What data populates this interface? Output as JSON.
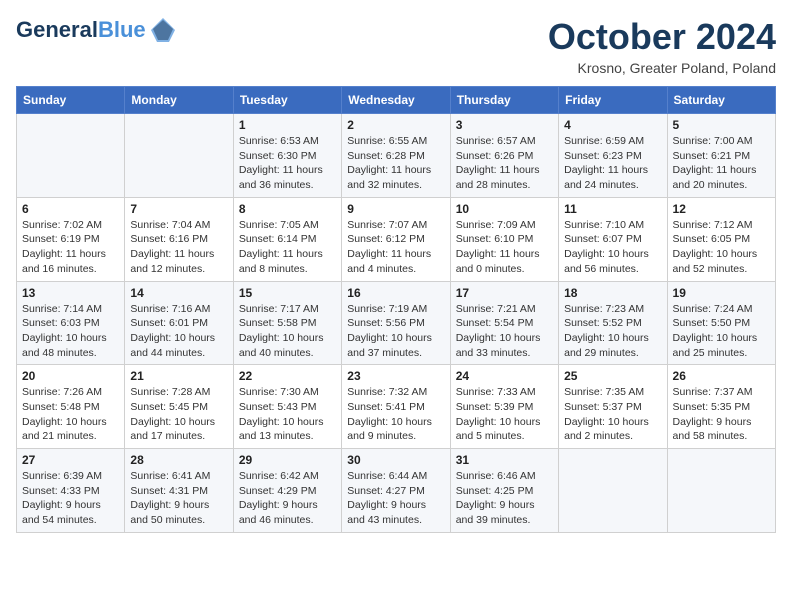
{
  "header": {
    "logo_line1": "General",
    "logo_line2": "Blue",
    "month": "October 2024",
    "location": "Krosno, Greater Poland, Poland"
  },
  "weekdays": [
    "Sunday",
    "Monday",
    "Tuesday",
    "Wednesday",
    "Thursday",
    "Friday",
    "Saturday"
  ],
  "weeks": [
    [
      {
        "day": "",
        "sunrise": "",
        "sunset": "",
        "daylight": ""
      },
      {
        "day": "",
        "sunrise": "",
        "sunset": "",
        "daylight": ""
      },
      {
        "day": "1",
        "sunrise": "Sunrise: 6:53 AM",
        "sunset": "Sunset: 6:30 PM",
        "daylight": "Daylight: 11 hours and 36 minutes."
      },
      {
        "day": "2",
        "sunrise": "Sunrise: 6:55 AM",
        "sunset": "Sunset: 6:28 PM",
        "daylight": "Daylight: 11 hours and 32 minutes."
      },
      {
        "day": "3",
        "sunrise": "Sunrise: 6:57 AM",
        "sunset": "Sunset: 6:26 PM",
        "daylight": "Daylight: 11 hours and 28 minutes."
      },
      {
        "day": "4",
        "sunrise": "Sunrise: 6:59 AM",
        "sunset": "Sunset: 6:23 PM",
        "daylight": "Daylight: 11 hours and 24 minutes."
      },
      {
        "day": "5",
        "sunrise": "Sunrise: 7:00 AM",
        "sunset": "Sunset: 6:21 PM",
        "daylight": "Daylight: 11 hours and 20 minutes."
      }
    ],
    [
      {
        "day": "6",
        "sunrise": "Sunrise: 7:02 AM",
        "sunset": "Sunset: 6:19 PM",
        "daylight": "Daylight: 11 hours and 16 minutes."
      },
      {
        "day": "7",
        "sunrise": "Sunrise: 7:04 AM",
        "sunset": "Sunset: 6:16 PM",
        "daylight": "Daylight: 11 hours and 12 minutes."
      },
      {
        "day": "8",
        "sunrise": "Sunrise: 7:05 AM",
        "sunset": "Sunset: 6:14 PM",
        "daylight": "Daylight: 11 hours and 8 minutes."
      },
      {
        "day": "9",
        "sunrise": "Sunrise: 7:07 AM",
        "sunset": "Sunset: 6:12 PM",
        "daylight": "Daylight: 11 hours and 4 minutes."
      },
      {
        "day": "10",
        "sunrise": "Sunrise: 7:09 AM",
        "sunset": "Sunset: 6:10 PM",
        "daylight": "Daylight: 11 hours and 0 minutes."
      },
      {
        "day": "11",
        "sunrise": "Sunrise: 7:10 AM",
        "sunset": "Sunset: 6:07 PM",
        "daylight": "Daylight: 10 hours and 56 minutes."
      },
      {
        "day": "12",
        "sunrise": "Sunrise: 7:12 AM",
        "sunset": "Sunset: 6:05 PM",
        "daylight": "Daylight: 10 hours and 52 minutes."
      }
    ],
    [
      {
        "day": "13",
        "sunrise": "Sunrise: 7:14 AM",
        "sunset": "Sunset: 6:03 PM",
        "daylight": "Daylight: 10 hours and 48 minutes."
      },
      {
        "day": "14",
        "sunrise": "Sunrise: 7:16 AM",
        "sunset": "Sunset: 6:01 PM",
        "daylight": "Daylight: 10 hours and 44 minutes."
      },
      {
        "day": "15",
        "sunrise": "Sunrise: 7:17 AM",
        "sunset": "Sunset: 5:58 PM",
        "daylight": "Daylight: 10 hours and 40 minutes."
      },
      {
        "day": "16",
        "sunrise": "Sunrise: 7:19 AM",
        "sunset": "Sunset: 5:56 PM",
        "daylight": "Daylight: 10 hours and 37 minutes."
      },
      {
        "day": "17",
        "sunrise": "Sunrise: 7:21 AM",
        "sunset": "Sunset: 5:54 PM",
        "daylight": "Daylight: 10 hours and 33 minutes."
      },
      {
        "day": "18",
        "sunrise": "Sunrise: 7:23 AM",
        "sunset": "Sunset: 5:52 PM",
        "daylight": "Daylight: 10 hours and 29 minutes."
      },
      {
        "day": "19",
        "sunrise": "Sunrise: 7:24 AM",
        "sunset": "Sunset: 5:50 PM",
        "daylight": "Daylight: 10 hours and 25 minutes."
      }
    ],
    [
      {
        "day": "20",
        "sunrise": "Sunrise: 7:26 AM",
        "sunset": "Sunset: 5:48 PM",
        "daylight": "Daylight: 10 hours and 21 minutes."
      },
      {
        "day": "21",
        "sunrise": "Sunrise: 7:28 AM",
        "sunset": "Sunset: 5:45 PM",
        "daylight": "Daylight: 10 hours and 17 minutes."
      },
      {
        "day": "22",
        "sunrise": "Sunrise: 7:30 AM",
        "sunset": "Sunset: 5:43 PM",
        "daylight": "Daylight: 10 hours and 13 minutes."
      },
      {
        "day": "23",
        "sunrise": "Sunrise: 7:32 AM",
        "sunset": "Sunset: 5:41 PM",
        "daylight": "Daylight: 10 hours and 9 minutes."
      },
      {
        "day": "24",
        "sunrise": "Sunrise: 7:33 AM",
        "sunset": "Sunset: 5:39 PM",
        "daylight": "Daylight: 10 hours and 5 minutes."
      },
      {
        "day": "25",
        "sunrise": "Sunrise: 7:35 AM",
        "sunset": "Sunset: 5:37 PM",
        "daylight": "Daylight: 10 hours and 2 minutes."
      },
      {
        "day": "26",
        "sunrise": "Sunrise: 7:37 AM",
        "sunset": "Sunset: 5:35 PM",
        "daylight": "Daylight: 9 hours and 58 minutes."
      }
    ],
    [
      {
        "day": "27",
        "sunrise": "Sunrise: 6:39 AM",
        "sunset": "Sunset: 4:33 PM",
        "daylight": "Daylight: 9 hours and 54 minutes."
      },
      {
        "day": "28",
        "sunrise": "Sunrise: 6:41 AM",
        "sunset": "Sunset: 4:31 PM",
        "daylight": "Daylight: 9 hours and 50 minutes."
      },
      {
        "day": "29",
        "sunrise": "Sunrise: 6:42 AM",
        "sunset": "Sunset: 4:29 PM",
        "daylight": "Daylight: 9 hours and 46 minutes."
      },
      {
        "day": "30",
        "sunrise": "Sunrise: 6:44 AM",
        "sunset": "Sunset: 4:27 PM",
        "daylight": "Daylight: 9 hours and 43 minutes."
      },
      {
        "day": "31",
        "sunrise": "Sunrise: 6:46 AM",
        "sunset": "Sunset: 4:25 PM",
        "daylight": "Daylight: 9 hours and 39 minutes."
      },
      {
        "day": "",
        "sunrise": "",
        "sunset": "",
        "daylight": ""
      },
      {
        "day": "",
        "sunrise": "",
        "sunset": "",
        "daylight": ""
      }
    ]
  ]
}
